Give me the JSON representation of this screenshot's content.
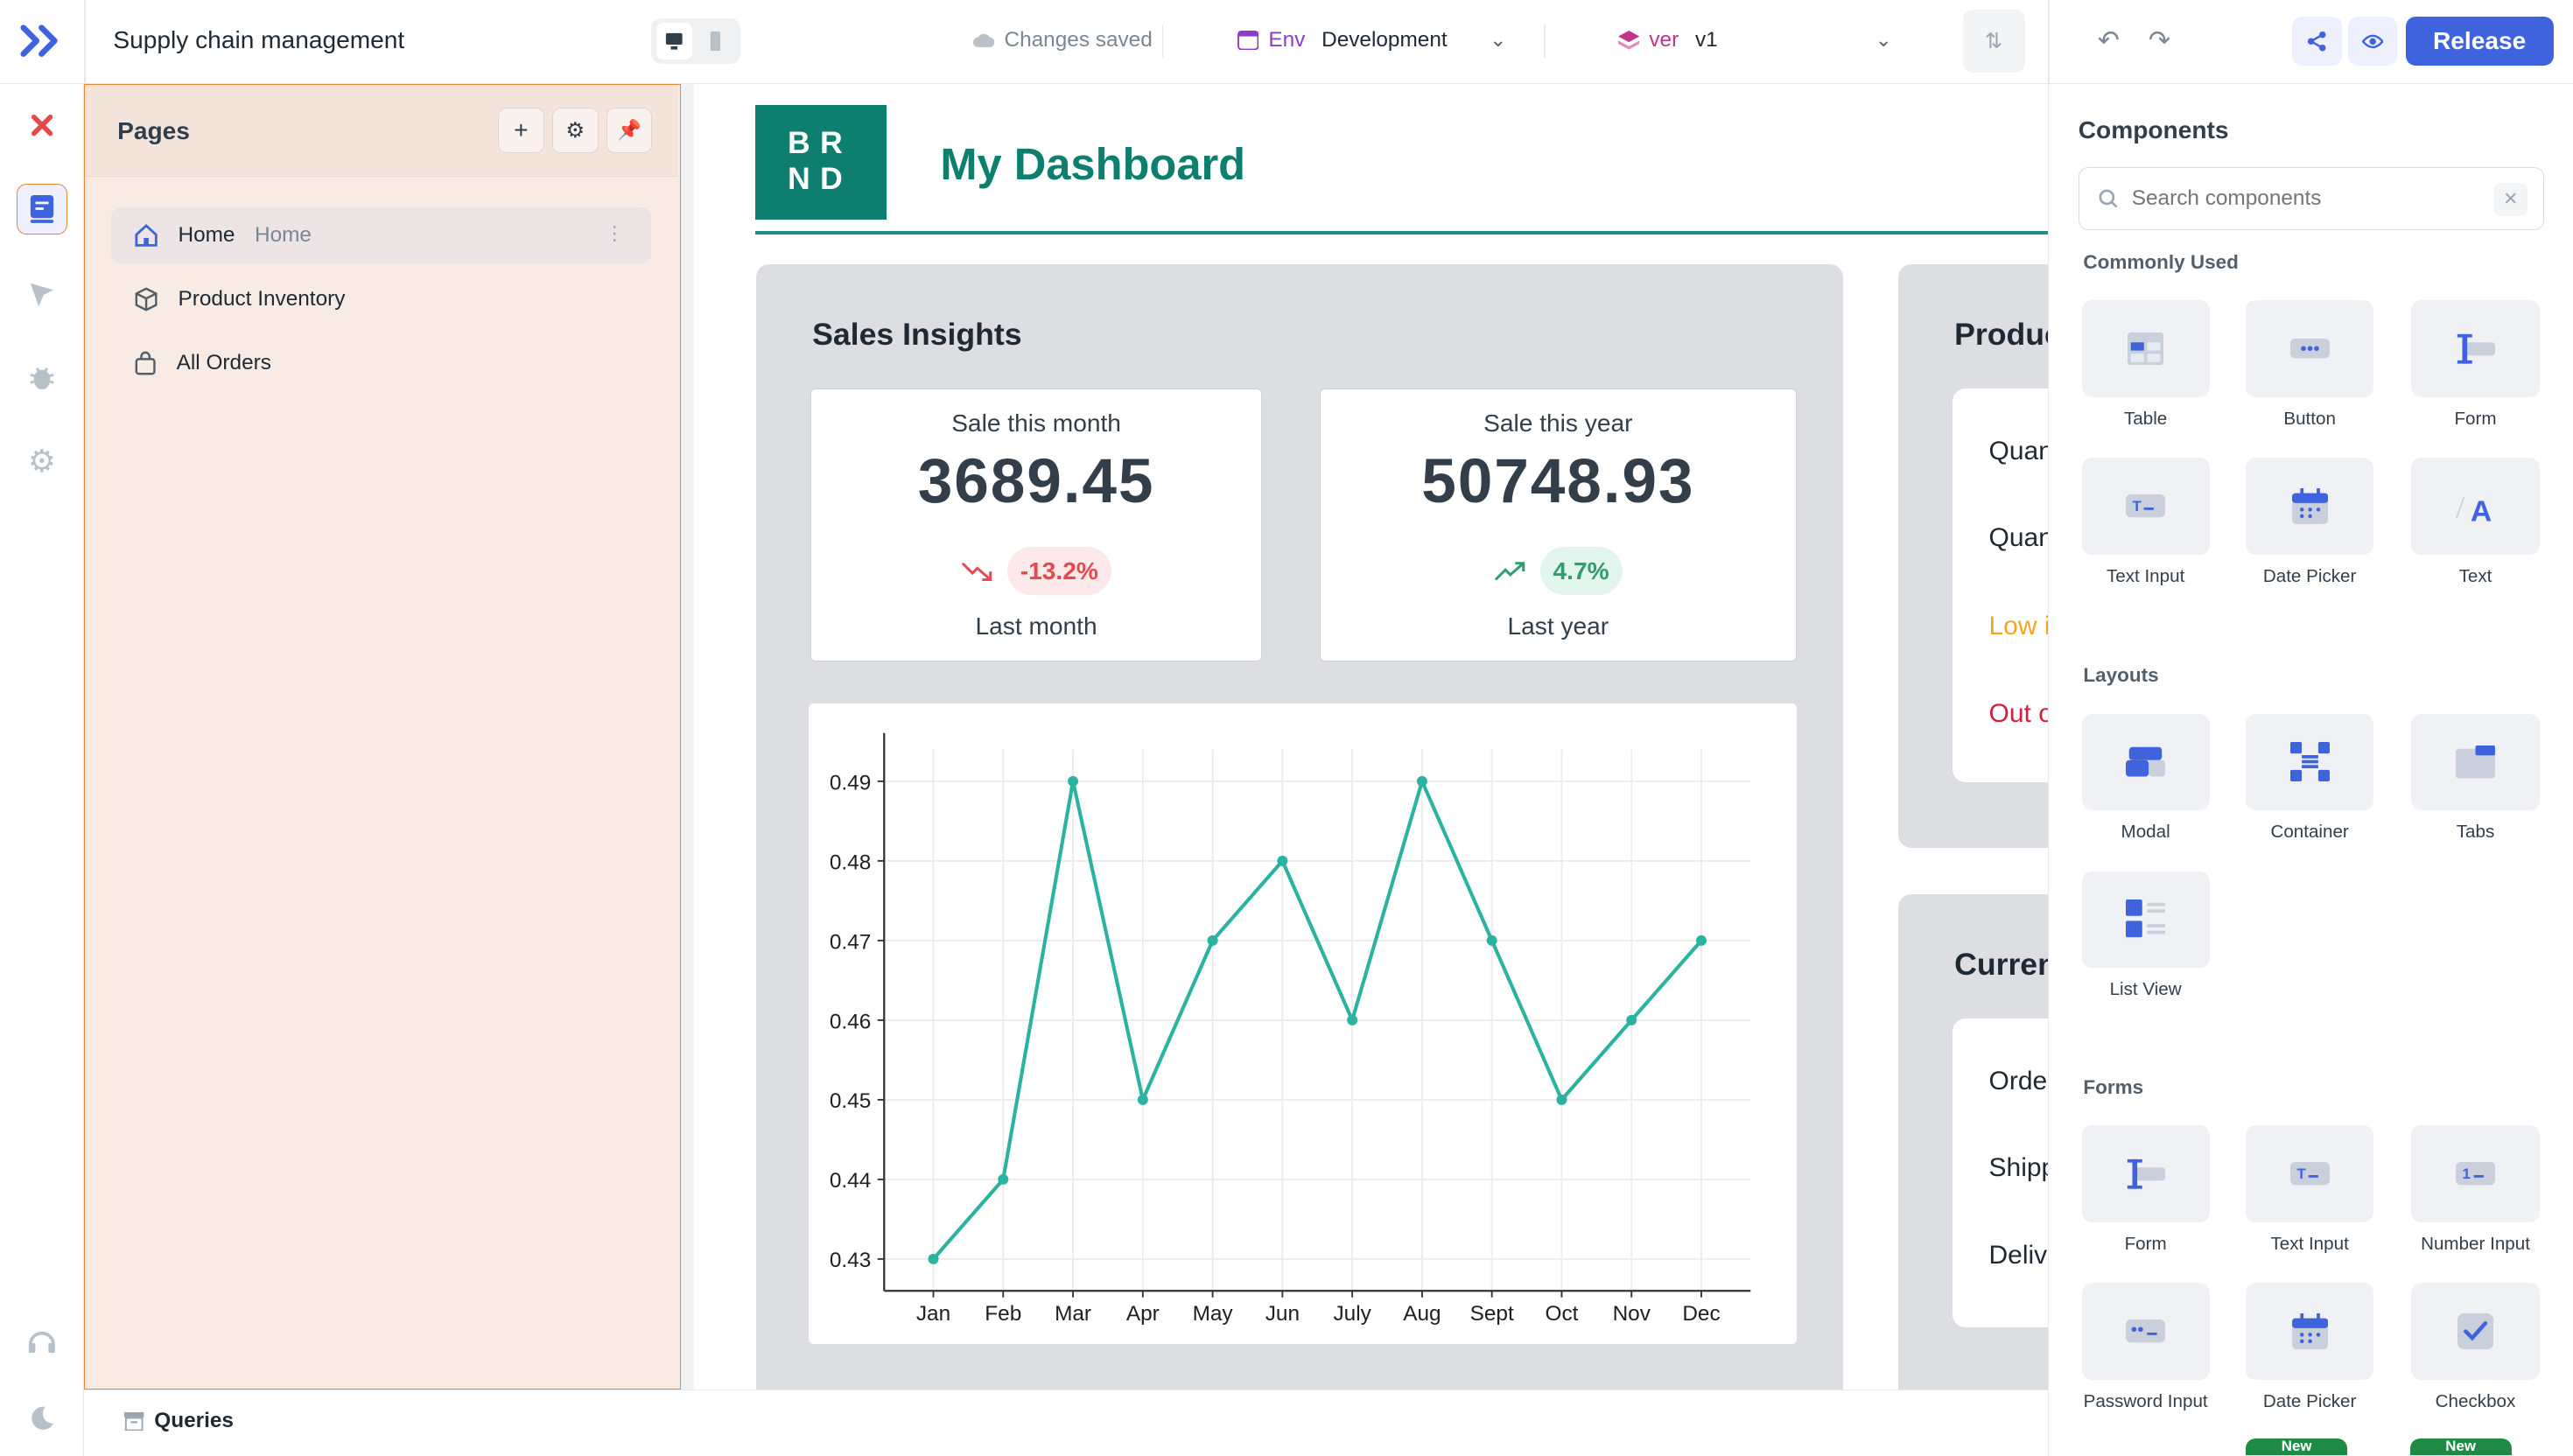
{
  "header": {
    "app_title": "Supply chain management",
    "save_status": "Changes saved",
    "env_tag": "Env",
    "env_value": "Development",
    "ver_tag": "ver",
    "ver_value": "v1",
    "release_label": "Release"
  },
  "pages_panel": {
    "title": "Pages",
    "items": [
      {
        "label": "Home",
        "sub": "Home",
        "icon": "home-icon",
        "active": true
      },
      {
        "label": "Product Inventory",
        "icon": "box-icon"
      },
      {
        "label": "All Orders",
        "icon": "shopping-bag-icon"
      }
    ]
  },
  "canvas": {
    "brand_line1": "BR",
    "brand_line2": "ND",
    "dashboard_title": "My Dashboard",
    "sales": {
      "title": "Sales Insights",
      "month": {
        "label": "Sale this month",
        "value": "3689.45",
        "change": "-13.2%",
        "foot": "Last month"
      },
      "year": {
        "label": "Sale this year",
        "value": "50748.93",
        "change": "4.7%",
        "foot": "Last year"
      }
    },
    "product_card": {
      "title": "Produc",
      "lines": [
        "Quant",
        "Quant",
        "Low ir",
        "Out of"
      ]
    },
    "current_card": {
      "title": "Current",
      "lines": [
        "Order",
        "Shipp",
        "Delive"
      ]
    }
  },
  "chart_data": {
    "type": "line",
    "categories": [
      "Jan",
      "Feb",
      "Mar",
      "Apr",
      "May",
      "Jun",
      "July",
      "Aug",
      "Sept",
      "Oct",
      "Nov",
      "Dec"
    ],
    "values": [
      0.43,
      0.44,
      0.49,
      0.45,
      0.47,
      0.48,
      0.46,
      0.49,
      0.47,
      0.45,
      0.46,
      0.47
    ],
    "yticks": [
      "0.43",
      "0.44",
      "0.45",
      "0.46",
      "0.47",
      "0.48",
      "0.49"
    ],
    "ylim": [
      0.426,
      0.494
    ],
    "color": "#2bb3a0",
    "grid": true
  },
  "components": {
    "title": "Components",
    "search_placeholder": "Search components",
    "sections": {
      "common": "Commonly Used",
      "layouts": "Layouts",
      "forms": "Forms"
    },
    "common_items": [
      "Table",
      "Button",
      "Form",
      "Text Input",
      "Date Picker",
      "Text"
    ],
    "layout_items": [
      "Modal",
      "Container",
      "Tabs",
      "List View"
    ],
    "form_items": [
      "Form",
      "Text Input",
      "Number Input",
      "Password Input",
      "Date Picker",
      "Checkbox"
    ],
    "new_badge": "New"
  },
  "bottom": {
    "queries_label": "Queries"
  },
  "colors": {
    "accent": "#3e63dd",
    "brand": "#0e7f6f",
    "line": "#2bb3a0",
    "negative": "#e5484d",
    "positive": "#2f9e6f"
  }
}
